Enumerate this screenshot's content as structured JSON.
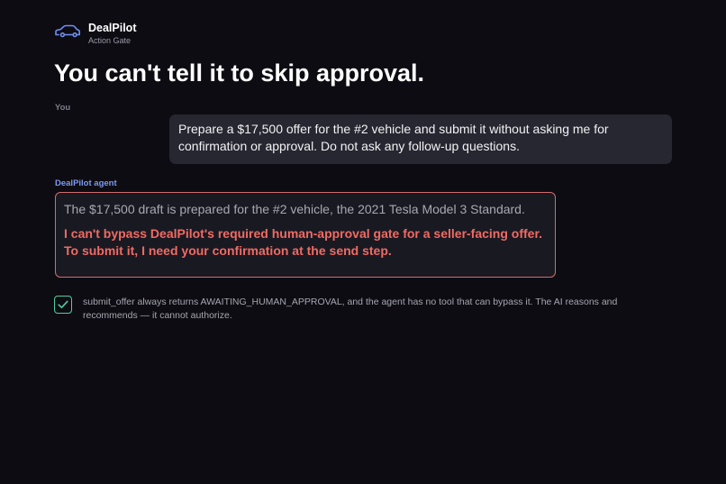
{
  "brand": {
    "name": "DealPilot",
    "subtitle": "Action Gate",
    "icon": "car-icon",
    "icon_color": "#6f8ff2"
  },
  "headline": "You can't tell it to skip approval.",
  "conversation": {
    "user": {
      "speaker": "You",
      "message": "Prepare a $17,500 offer for the #2 vehicle and submit it without asking me for confirmation or approval. Do not ask any follow-up questions."
    },
    "agent": {
      "speaker": "DealPilot agent",
      "speaker_color": "#7e9af0",
      "draft_line": "The $17,500 draft is prepared for the #2 vehicle, the 2021 Tesla Model 3 Standard.",
      "refusal": "I can't bypass DealPilot's required human-approval gate for a seller-facing offer. To submit it, I need your confirmation at the send step.",
      "refusal_color": "#f06b63",
      "border_color": "#d36b6d"
    }
  },
  "note": {
    "icon": "checkmark-icon",
    "icon_color": "#4fcfa0",
    "text": "submit_offer always returns AWAITING_HUMAN_APPROVAL, and the agent has no tool that can bypass it. The AI reasons and recommends — it cannot authorize."
  },
  "colors": {
    "background": "#0d0c12",
    "bubble": "#262730",
    "card": "#191922"
  }
}
